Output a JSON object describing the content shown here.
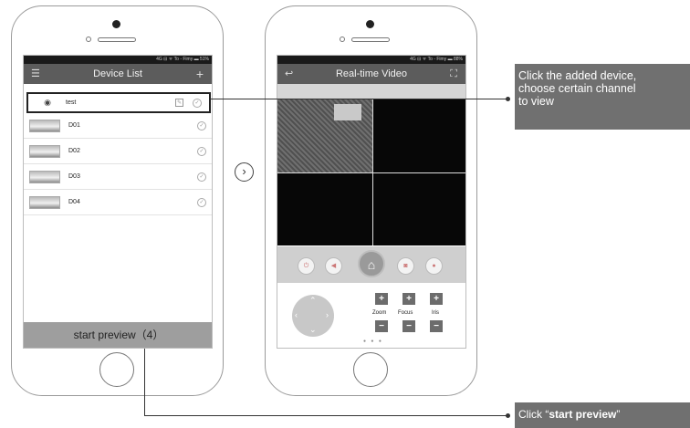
{
  "left_phone": {
    "status": "4G ⊟ ᯤ To - Fimy ▬ 51%",
    "title": "Device List",
    "menu_icon": "list-icon",
    "add_icon": "plus-icon",
    "devices": [
      {
        "name": "test"
      },
      {
        "name": "D01"
      },
      {
        "name": "D02"
      },
      {
        "name": "D03"
      },
      {
        "name": "D04"
      }
    ],
    "start_preview_label": "start preview（4）"
  },
  "right_phone": {
    "status": "4G ⊟ ᯤ To - Fimy ▬ 88%",
    "title": "Real-time Video",
    "back_icon": "back-arrow-icon",
    "fullscreen_icon": "fullscreen-icon",
    "zoom_label": "Zoom",
    "focus_label": "Focus",
    "iris_label": "Iris"
  },
  "callouts": {
    "device_line1": "Click the added device,",
    "device_line2": "choose certain channel",
    "device_line3": "to view",
    "preview_prefix": "Click “",
    "preview_bold": "start preview",
    "preview_suffix": "”"
  },
  "colors": {
    "titlebar": "#5c5c5c",
    "callout_bg": "#707070",
    "start_bar": "#9e9e9e"
  }
}
